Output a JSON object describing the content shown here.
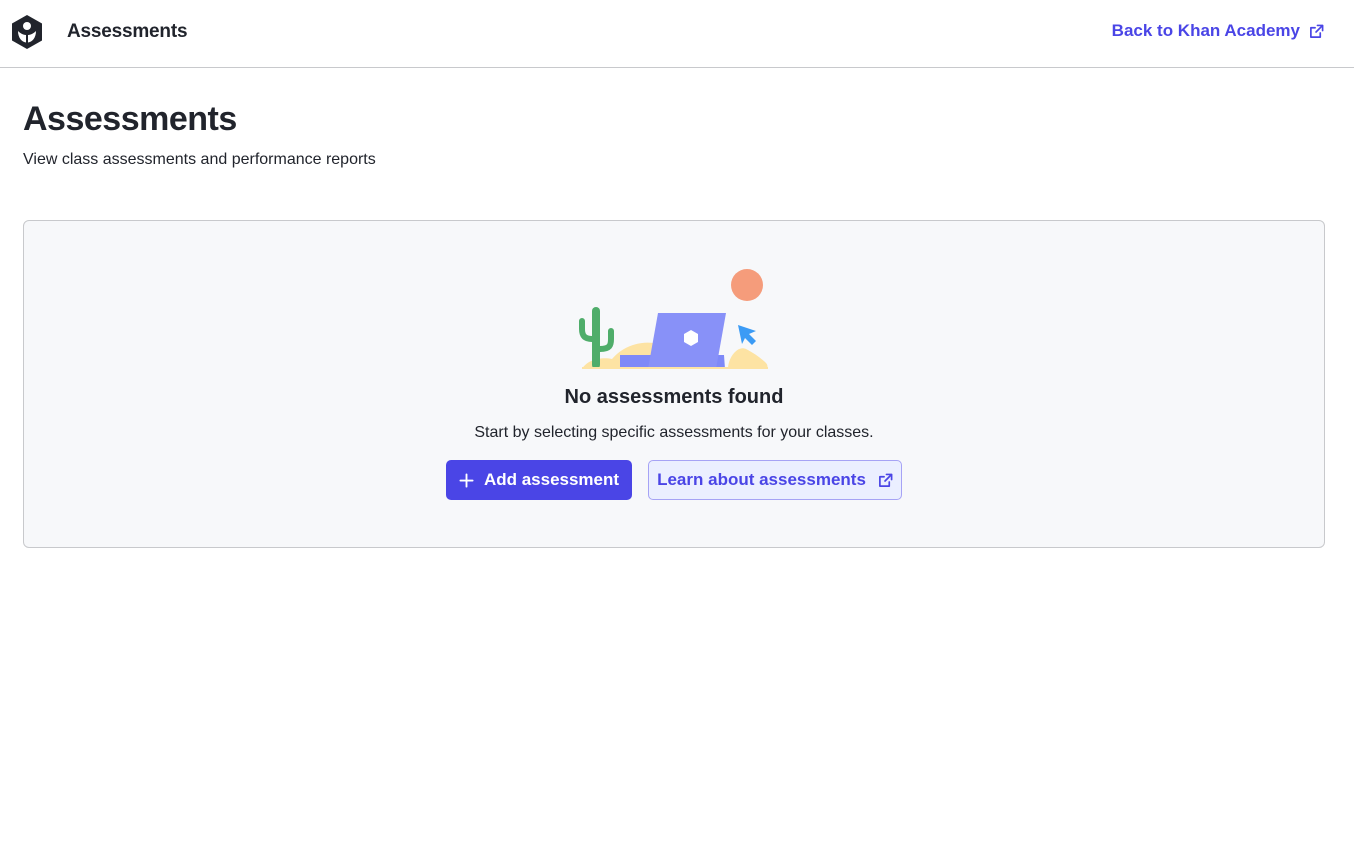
{
  "header": {
    "app_title": "Assessments",
    "back_link": "Back to Khan Academy",
    "logo_icon": "khan-academy-logo-icon",
    "back_link_icon": "external-link-icon"
  },
  "page": {
    "title": "Assessments",
    "subtitle": "View class assessments and performance reports"
  },
  "empty_state": {
    "illustration": "desert-laptop-illustration",
    "heading": "No assessments found",
    "text": "Start by selecting specific assessments for your classes.",
    "add_button": "Add assessment",
    "add_button_icon": "plus-icon",
    "learn_button": "Learn about assessments",
    "learn_button_icon": "external-link-icon"
  },
  "colors": {
    "accent": "#4a45e6",
    "accent_light": "#ebefff",
    "card_bg": "#f7f8fa",
    "text": "#21242c",
    "border": "#c8c9cc"
  }
}
